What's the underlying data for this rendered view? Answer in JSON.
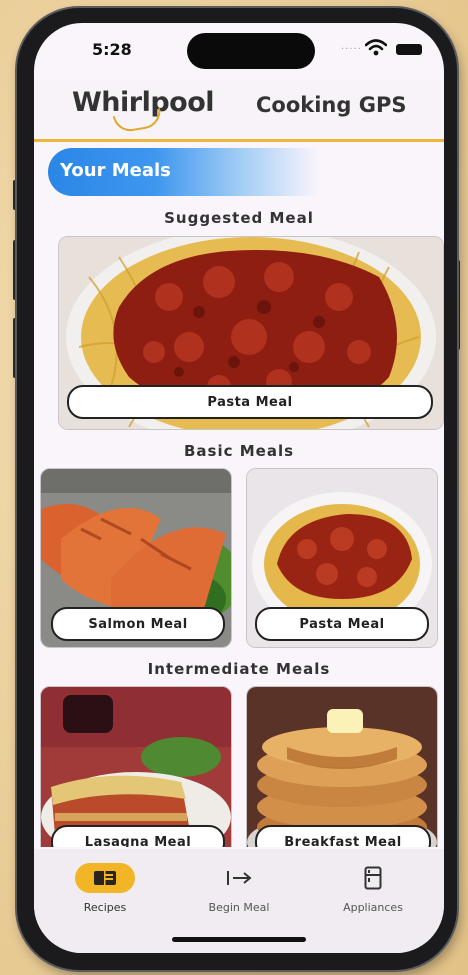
{
  "status_bar": {
    "time": "5:28",
    "signal_dots": "....."
  },
  "header": {
    "brand": "Whirlpool",
    "title": "Cooking GPS"
  },
  "banner": {
    "label": "Your Meals"
  },
  "sections": {
    "suggested": {
      "title": "Suggested Meal",
      "meal": "Pasta Meal"
    },
    "basic": {
      "title": "Basic Meals",
      "meals": [
        "Salmon Meal",
        "Pasta Meal"
      ]
    },
    "intermediate": {
      "title": "Intermediate Meals",
      "meals": [
        "Lasagna Meal",
        "Breakfast Meal"
      ]
    }
  },
  "tabbar": {
    "items": [
      {
        "label": "Recipes",
        "icon": "book-icon",
        "active": true
      },
      {
        "label": "Begin Meal",
        "icon": "arrow-to-line-icon",
        "active": false
      },
      {
        "label": "Appliances",
        "icon": "fridge-icon",
        "active": false
      }
    ]
  },
  "colors": {
    "accent": "#f0b63b",
    "banner_blue": "#2a86e6",
    "active_tab": "#f2b526"
  }
}
